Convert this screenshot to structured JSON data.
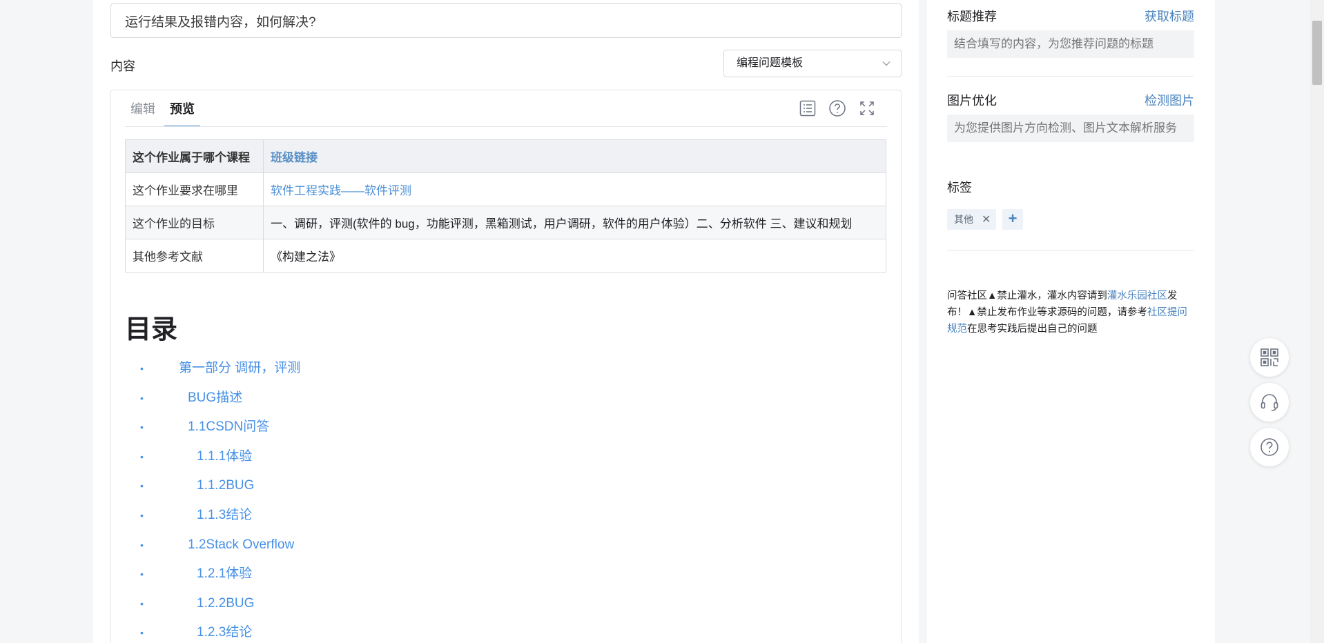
{
  "question": {
    "title_value": "运行结果及报错内容，如何解决?",
    "content_label": "内容",
    "template_select": "编程问题模板"
  },
  "editor": {
    "tabs": [
      {
        "label": "编辑",
        "active": false
      },
      {
        "label": "预览",
        "active": true
      }
    ],
    "tool_icons": [
      "toc-list-icon",
      "help-circle-icon",
      "fullscreen-icon"
    ],
    "info_table": [
      {
        "key": "这个作业属于哪个课程",
        "value": "班级链接",
        "link": true
      },
      {
        "key": "这个作业要求在哪里",
        "value": "软件工程实践——软件评测",
        "link": true
      },
      {
        "key": "这个作业的目标",
        "value": "一、调研，评测(软件的 bug，功能评测，黑箱测试，用户调研，软件的用户体验）二、分析软件 三、建议和规划",
        "link": false
      },
      {
        "key": "其他参考文献",
        "value": "《构建之法》",
        "link": false
      }
    ],
    "toc_title": "目录",
    "toc_items": [
      {
        "text": "第一部分 调研，评测",
        "level": 1
      },
      {
        "text": "BUG描述",
        "level": 2
      },
      {
        "text": "1.1CSDN问答",
        "level": 2
      },
      {
        "text": "1.1.1体验",
        "level": 3
      },
      {
        "text": "1.1.2BUG",
        "level": 3
      },
      {
        "text": "1.1.3结论",
        "level": 3
      },
      {
        "text": "1.2Stack Overflow",
        "level": 2
      },
      {
        "text": "1.2.1体验",
        "level": 3
      },
      {
        "text": "1.2.2BUG",
        "level": 3
      },
      {
        "text": "1.2.3结论",
        "level": 3
      }
    ],
    "bullet": "•"
  },
  "sidebar": {
    "title_recommend": {
      "heading": "标题推荐",
      "action": "获取标题",
      "placeholder": "结合填写的内容，为您推荐问题的标题"
    },
    "image_optimize": {
      "heading": "图片优化",
      "action": "检测图片",
      "placeholder": "为您提供图片方向检测、图片文本解析服务"
    },
    "tags": {
      "heading": "标签",
      "items": [
        "其他"
      ],
      "remove_glyph": "✕",
      "add_glyph": "+"
    },
    "notice": {
      "p1": "问答社区▲禁止灌水，灌水内容请到",
      "link1": "灌水乐园社区",
      "p2": "发布！▲禁止发布作业等求源码的问题，请参考",
      "link2": "社区提问规范",
      "p3": "在思考实践后提出自己的问题"
    }
  },
  "floating_buttons": [
    "qrcode-icon",
    "headset-icon",
    "help-icon"
  ],
  "colors": {
    "accent": "#4a83bd",
    "link": "#4690e6",
    "background": "#f5f6f7"
  }
}
